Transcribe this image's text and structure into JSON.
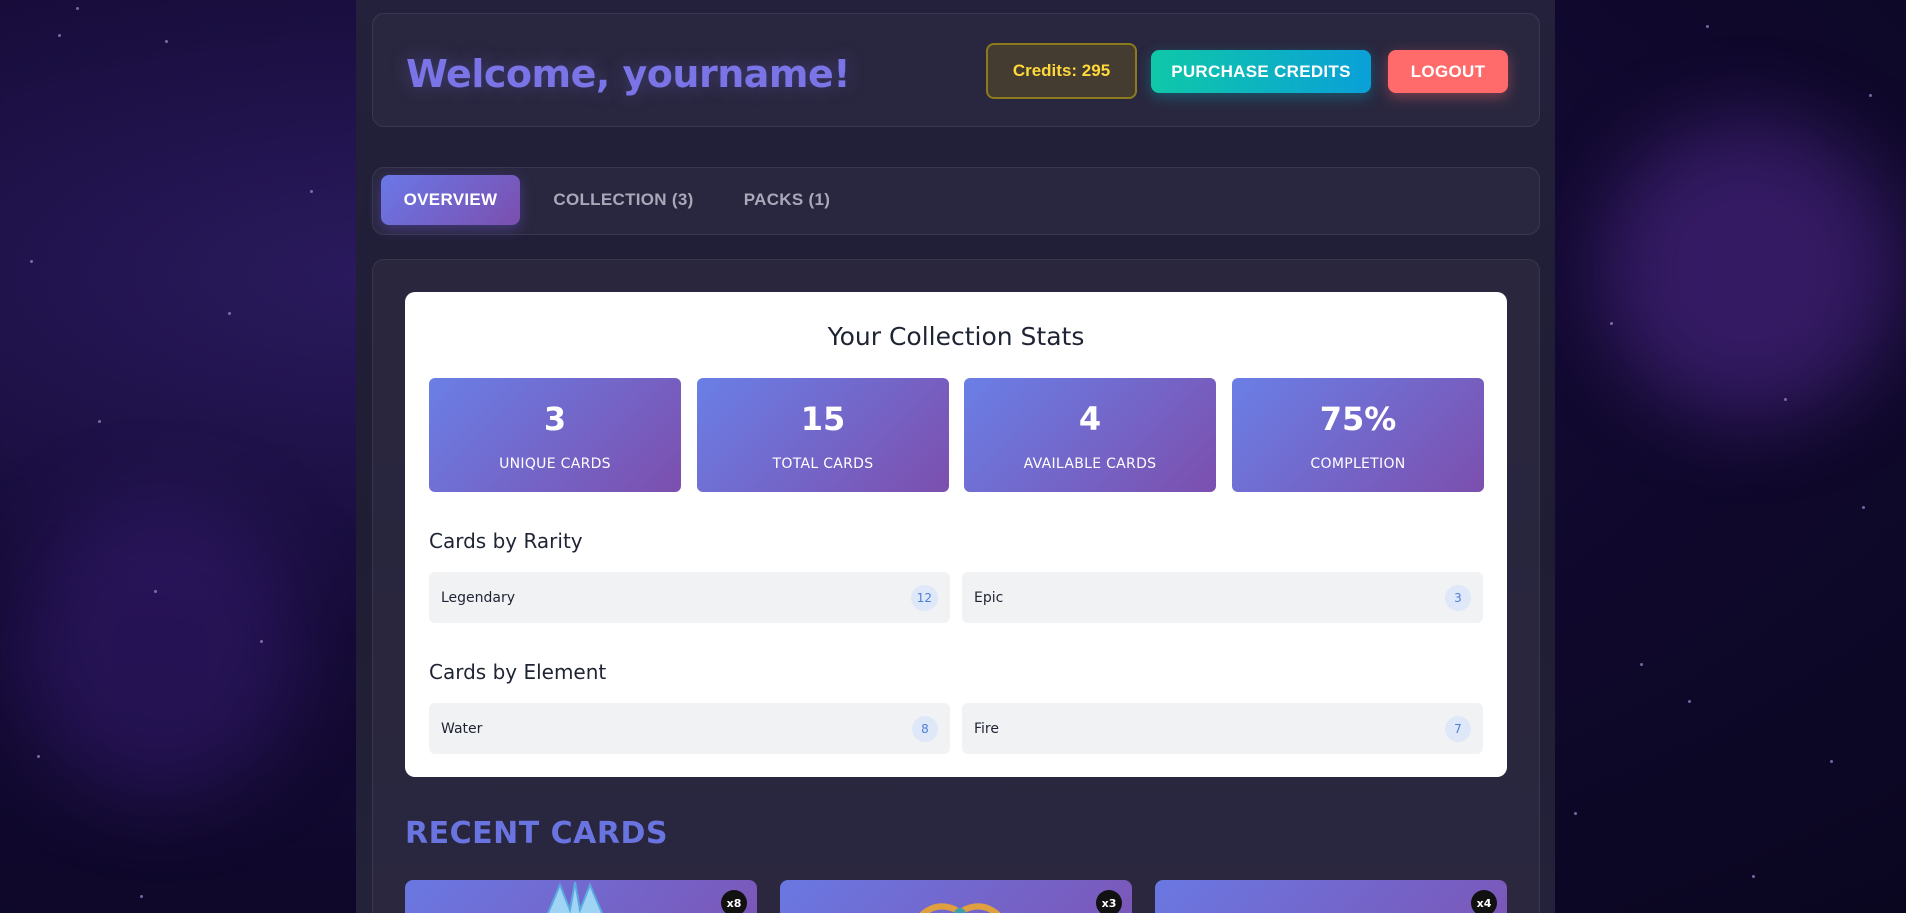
{
  "header": {
    "welcome": "Welcome, yourname!",
    "credits": "Credits: 295",
    "purchase_label": "PURCHASE CREDITS",
    "logout_label": "LOGOUT"
  },
  "tabs": [
    {
      "label": "OVERVIEW",
      "active": true
    },
    {
      "label": "COLLECTION (3)",
      "active": false
    },
    {
      "label": "PACKS (1)",
      "active": false
    }
  ],
  "stats": {
    "title": "Your Collection Stats",
    "tiles": [
      {
        "value": "3",
        "label": "UNIQUE CARDS"
      },
      {
        "value": "15",
        "label": "TOTAL CARDS"
      },
      {
        "value": "4",
        "label": "AVAILABLE CARDS"
      },
      {
        "value": "75%",
        "label": "COMPLETION"
      }
    ],
    "rarity_heading": "Cards by Rarity",
    "rarity": [
      {
        "label": "Legendary",
        "count": "12"
      },
      {
        "label": "Epic",
        "count": "3"
      }
    ],
    "element_heading": "Cards by Element",
    "element": [
      {
        "label": "Water",
        "count": "8"
      },
      {
        "label": "Fire",
        "count": "7"
      }
    ]
  },
  "recent": {
    "title": "RECENT CARDS",
    "cards": [
      {
        "qty": "x8",
        "art": "water-bird-icon"
      },
      {
        "qty": "x3",
        "art": "fire-dragon-icon"
      },
      {
        "qty": "x4",
        "art": "card-art-icon"
      }
    ]
  },
  "colors": {
    "accent": "#6a74e0",
    "purchase": "#0fc8a8",
    "logout": "#ff6b6b",
    "credits": "#ffd93b"
  }
}
